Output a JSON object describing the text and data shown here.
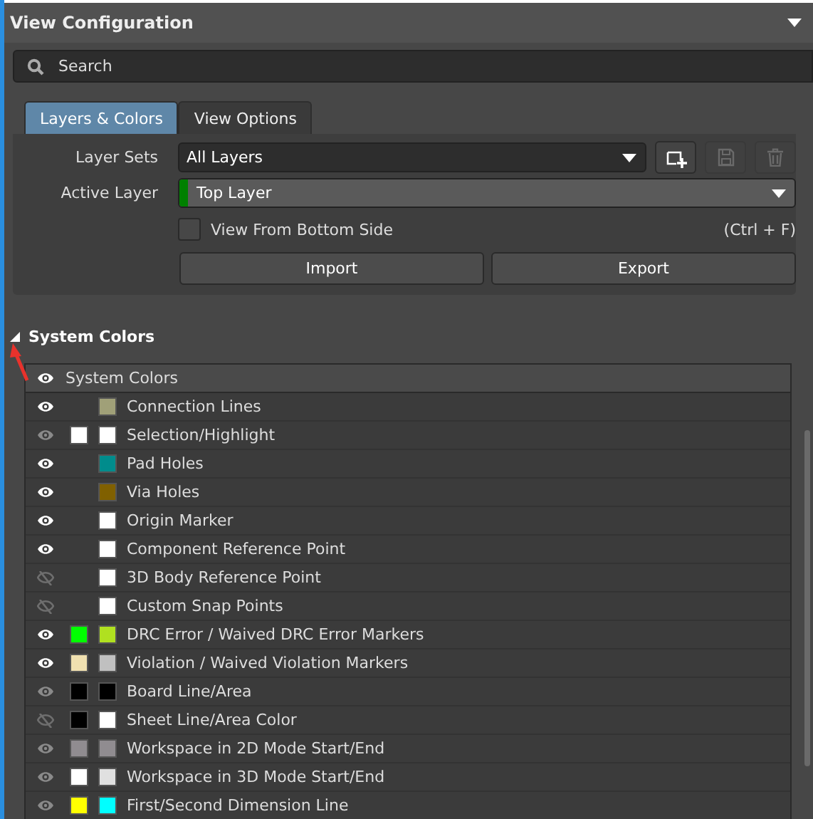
{
  "panel": {
    "title": "View Configuration"
  },
  "search": {
    "placeholder": "Search"
  },
  "tabs": [
    {
      "label": "Layers & Colors",
      "selected": true
    },
    {
      "label": "View Options",
      "selected": false
    }
  ],
  "layer_sets": {
    "label": "Layer Sets",
    "value": "All Layers"
  },
  "active_layer": {
    "label": "Active Layer",
    "value": "Top Layer",
    "color": "#008000"
  },
  "view_from_bottom": {
    "label": "View From Bottom Side",
    "checked": false,
    "shortcut": "(Ctrl + F)"
  },
  "buttons": [
    "Import",
    "Export"
  ],
  "section": {
    "title": "System Colors",
    "expanded": true
  },
  "table": {
    "header": "System Colors",
    "rows": [
      {
        "name": "Connection Lines",
        "visible": true,
        "dimmed": false,
        "color": "#a0a078"
      },
      {
        "name": "Selection/Highlight",
        "visible": true,
        "dimmed": true,
        "alt_swatch": {
          "color": "#ffffff"
        },
        "color": "#ffffff"
      },
      {
        "name": "Pad Holes",
        "visible": true,
        "dimmed": false,
        "color": "#008c8c"
      },
      {
        "name": "Via Holes",
        "visible": true,
        "dimmed": false,
        "color": "#806000"
      },
      {
        "name": "Origin Marker",
        "visible": true,
        "dimmed": false,
        "color": "#ffffff"
      },
      {
        "name": "Component Reference Point",
        "visible": true,
        "dimmed": false,
        "color": "#ffffff"
      },
      {
        "name": "3D Body Reference Point",
        "visible": false,
        "dimmed": true,
        "color": "#ffffff"
      },
      {
        "name": "Custom Snap Points",
        "visible": false,
        "dimmed": true,
        "color": "#ffffff"
      },
      {
        "name": "DRC Error / Waived DRC Error Markers",
        "visible": true,
        "dimmed": false,
        "alt_swatch": {
          "color": "#00ff00"
        },
        "color": "#b0e020"
      },
      {
        "name": "Violation / Waived Violation Markers",
        "visible": true,
        "dimmed": false,
        "alt_swatch": {
          "color": "#f0e0b0"
        },
        "color": "#c0c0c0"
      },
      {
        "name": "Board Line/Area",
        "visible": true,
        "dimmed": true,
        "alt_swatch": {
          "color": "#000000"
        },
        "color": "#000000"
      },
      {
        "name": "Sheet Line/Area Color",
        "visible": false,
        "dimmed": true,
        "alt_swatch": {
          "color": "#000000"
        },
        "color": "#ffffff"
      },
      {
        "name": "Workspace in 2D Mode Start/End",
        "visible": true,
        "dimmed": true,
        "alt_swatch": {
          "color": "#908c90"
        },
        "color": "#908c90"
      },
      {
        "name": "Workspace in 3D Mode Start/End",
        "visible": true,
        "dimmed": true,
        "alt_swatch": {
          "color": "#ffffff"
        },
        "color": "#e0e0e0"
      },
      {
        "name": "First/Second Dimension Line",
        "visible": true,
        "dimmed": true,
        "alt_swatch": {
          "color": "#ffff00"
        },
        "color": "#00ffff"
      }
    ]
  }
}
